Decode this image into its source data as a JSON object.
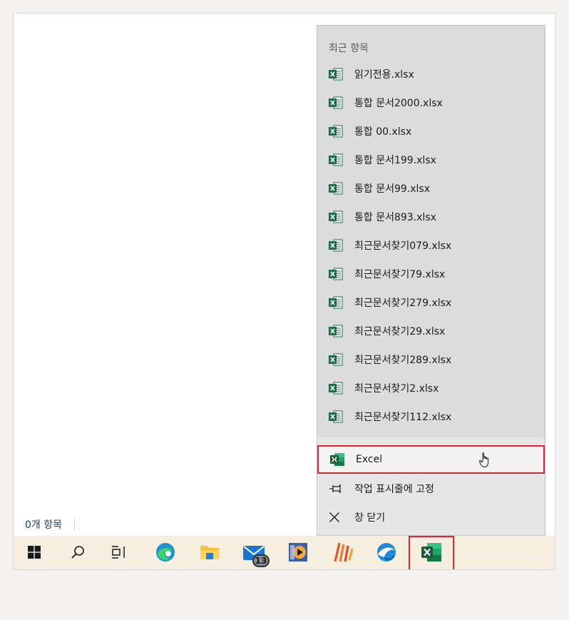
{
  "explorer": {
    "status_count": "0개 항목"
  },
  "jumplist": {
    "header": "최근 항목",
    "recent_items": [
      {
        "label": "읽기전용.xlsx"
      },
      {
        "label": "통합 문서2000.xlsx"
      },
      {
        "label": "통합 00.xlsx"
      },
      {
        "label": "통합 문서199.xlsx"
      },
      {
        "label": "통합 문서99.xlsx"
      },
      {
        "label": "통합 문서893.xlsx"
      },
      {
        "label": "최근문서찾기079.xlsx"
      },
      {
        "label": "최근문서찾기79.xlsx"
      },
      {
        "label": "최근문서찾기279.xlsx"
      },
      {
        "label": "최근문서찾기29.xlsx"
      },
      {
        "label": "최근문서찾기289.xlsx"
      },
      {
        "label": "최근문서찾기2.xlsx"
      },
      {
        "label": "최근문서찾기112.xlsx"
      }
    ],
    "tasks": {
      "app": "Excel",
      "pin": "작업 표시줄에 고정",
      "close": "창 닫기"
    }
  },
  "taskbar": {
    "items": [
      "start",
      "search",
      "task-view",
      "edge",
      "file-explorer",
      "mail",
      "media-player",
      "app-stripes",
      "browser-whale",
      "excel"
    ],
    "mail_badge": "13"
  },
  "colors": {
    "highlight": "#e4232a",
    "taskbar_bg": "#f6eedf",
    "jumplist_bg": "#dcdcdc",
    "excel_green": "#1d7044",
    "underline_blue": "#1f80d8"
  }
}
